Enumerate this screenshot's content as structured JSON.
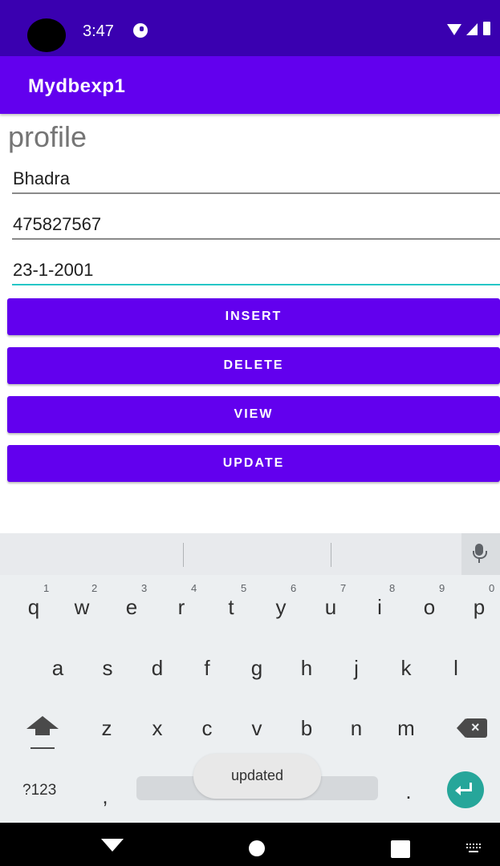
{
  "status_bar": {
    "time": "3:47"
  },
  "app_bar": {
    "title": "Mydbexp1"
  },
  "form": {
    "heading": "profile",
    "name_value": "Bhadra",
    "phone_value": "475827567",
    "dob_value": "23-1-2001"
  },
  "buttons": {
    "insert": "INSERT",
    "delete": "DELETE",
    "view": "VIEW",
    "update": "UPDATE"
  },
  "keyboard": {
    "row1": [
      {
        "key": "q",
        "hint": "1"
      },
      {
        "key": "w",
        "hint": "2"
      },
      {
        "key": "e",
        "hint": "3"
      },
      {
        "key": "r",
        "hint": "4"
      },
      {
        "key": "t",
        "hint": "5"
      },
      {
        "key": "y",
        "hint": "6"
      },
      {
        "key": "u",
        "hint": "7"
      },
      {
        "key": "i",
        "hint": "8"
      },
      {
        "key": "o",
        "hint": "9"
      },
      {
        "key": "p",
        "hint": "0"
      }
    ],
    "row2": [
      "a",
      "s",
      "d",
      "f",
      "g",
      "h",
      "j",
      "k",
      "l"
    ],
    "row3": [
      "z",
      "x",
      "c",
      "v",
      "b",
      "n",
      "m"
    ],
    "symbols_key": "?123",
    "comma_key": ",",
    "period_key": "."
  },
  "toast": {
    "message": "updated"
  },
  "icons": {
    "status": [
      "notification-icon",
      "wifi-icon",
      "signal-icon",
      "battery-icon"
    ],
    "keyboard": [
      "mic-icon",
      "shift-icon",
      "backspace-icon",
      "enter-icon"
    ],
    "nav": [
      "back-icon",
      "home-icon",
      "recents-icon",
      "keyboard-switch-icon"
    ]
  },
  "colors": {
    "status_bar": "#3a00b0",
    "primary": "#6200ee",
    "focus_underline": "#26c6c6",
    "enter_key": "#26a69a"
  }
}
